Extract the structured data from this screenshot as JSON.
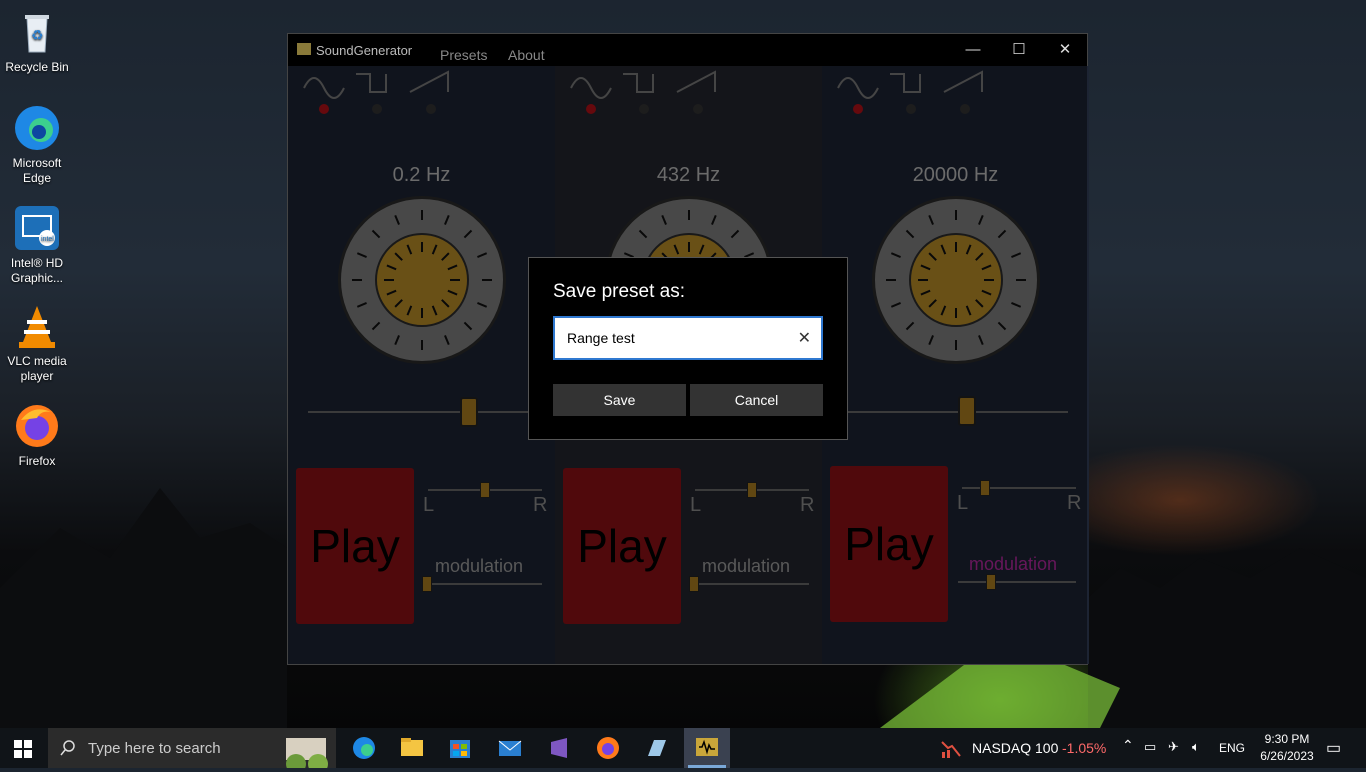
{
  "desktop": {
    "icons": [
      {
        "label": "Recycle Bin"
      },
      {
        "label": "Microsoft Edge"
      },
      {
        "label": "Intel® HD Graphic..."
      },
      {
        "label": "VLC media player"
      },
      {
        "label": "Firefox"
      }
    ]
  },
  "window": {
    "title": "SoundGenerator",
    "menu": [
      "Presets",
      "About"
    ],
    "controls": {
      "minimize": "—",
      "maximize": "☐",
      "close": "✕"
    }
  },
  "generators": [
    {
      "frequency": "0.2 Hz",
      "play_label": "Play",
      "left_label": "L",
      "right_label": "R",
      "modulation_label": "modulation",
      "modulation_active": false,
      "waveform_selected": "sine"
    },
    {
      "frequency": "432 Hz",
      "play_label": "Play",
      "left_label": "L",
      "right_label": "R",
      "modulation_label": "modulation",
      "modulation_active": false,
      "waveform_selected": "sine"
    },
    {
      "frequency": "20000 Hz",
      "play_label": "Play",
      "left_label": "L",
      "right_label": "R",
      "modulation_label": "modulation",
      "modulation_active": true,
      "waveform_selected": "sine"
    }
  ],
  "dialog": {
    "title": "Save preset as:",
    "input_value": "Range test",
    "save_label": "Save",
    "cancel_label": "Cancel"
  },
  "taskbar": {
    "search_placeholder": "Type here to search",
    "ticker_name": "NASDAQ 100",
    "ticker_change": "-1.05%",
    "language": "ENG",
    "time": "9:30 PM",
    "date": "6/26/2023"
  },
  "colors": {
    "accent": "#2f78d0",
    "play": "#8a1015",
    "knob_gold": "#b68a26",
    "modulation_active": "#b0289c",
    "ticker_negative": "#ff6a6a"
  }
}
